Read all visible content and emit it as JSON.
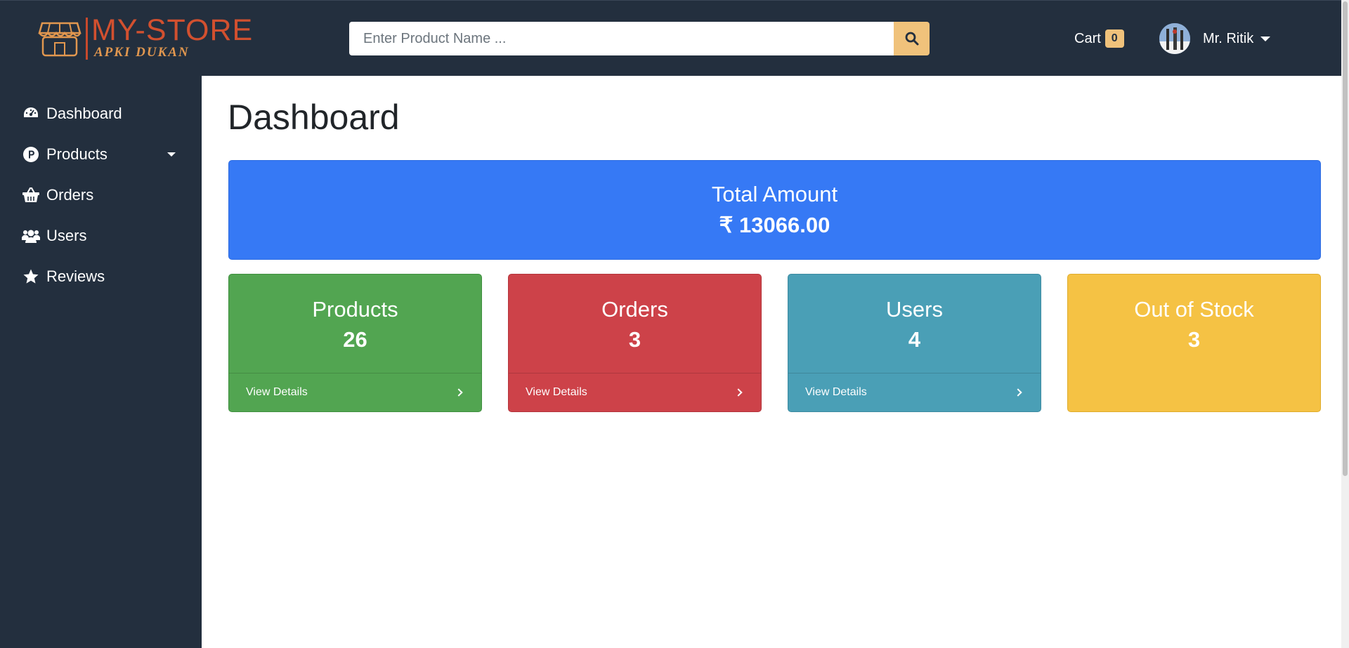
{
  "header": {
    "logo_title": "MY-STORE",
    "logo_subtitle": "APKI DUKAN",
    "search_placeholder": "Enter Product Name ...",
    "search_icon": "search-icon",
    "cart_label": "Cart",
    "cart_count": "0",
    "user_name": "Mr. Ritik",
    "accent_color": "#f0c27b",
    "background_color": "#232f3e"
  },
  "sidebar": {
    "items": [
      {
        "label": "Dashboard",
        "icon": "tachometer-icon"
      },
      {
        "label": "Products",
        "icon": "product-circle-icon",
        "has_dropdown": true
      },
      {
        "label": "Orders",
        "icon": "basket-icon"
      },
      {
        "label": "Users",
        "icon": "users-icon"
      },
      {
        "label": "Reviews",
        "icon": "star-icon"
      }
    ]
  },
  "main": {
    "title": "Dashboard",
    "total": {
      "label": "Total Amount",
      "value": "₹ 13066.00",
      "color": "#3679f5"
    },
    "cards": [
      {
        "label": "Products",
        "value": "26",
        "footer": "View Details",
        "color": "#52a551"
      },
      {
        "label": "Orders",
        "value": "3",
        "footer": "View Details",
        "color": "#cd4249"
      },
      {
        "label": "Users",
        "value": "4",
        "footer": "View Details",
        "color": "#4a9fb6"
      },
      {
        "label": "Out of Stock",
        "value": "3",
        "color": "#f5c244"
      }
    ]
  }
}
